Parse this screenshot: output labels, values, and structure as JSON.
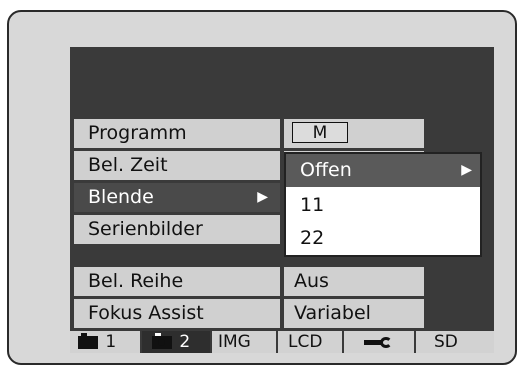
{
  "menu": {
    "rows": [
      {
        "label": "Programm",
        "value": "M"
      },
      {
        "label": "Bel. Zeit",
        "value": ""
      },
      {
        "label": "Blende",
        "value": "",
        "arrow": "▶"
      },
      {
        "label": "Serienbilder",
        "value": ""
      },
      {
        "label": "Bel. Reihe",
        "value": "Aus"
      },
      {
        "label": "Fokus Assist",
        "value": "Variabel"
      }
    ],
    "selected_index": 2
  },
  "popup": {
    "options": [
      {
        "label": "Offen",
        "arrow": "▶"
      },
      {
        "label": "11"
      },
      {
        "label": "22"
      }
    ],
    "highlighted_index": 0
  },
  "tabs": [
    {
      "label": "1",
      "icon": "camera-icon"
    },
    {
      "label": "2",
      "icon": "camera-icon"
    },
    {
      "label": "IMG"
    },
    {
      "label": "LCD"
    },
    {
      "label": "",
      "icon": "wrench-icon"
    },
    {
      "label": "SD"
    }
  ],
  "active_tab_index": 1
}
